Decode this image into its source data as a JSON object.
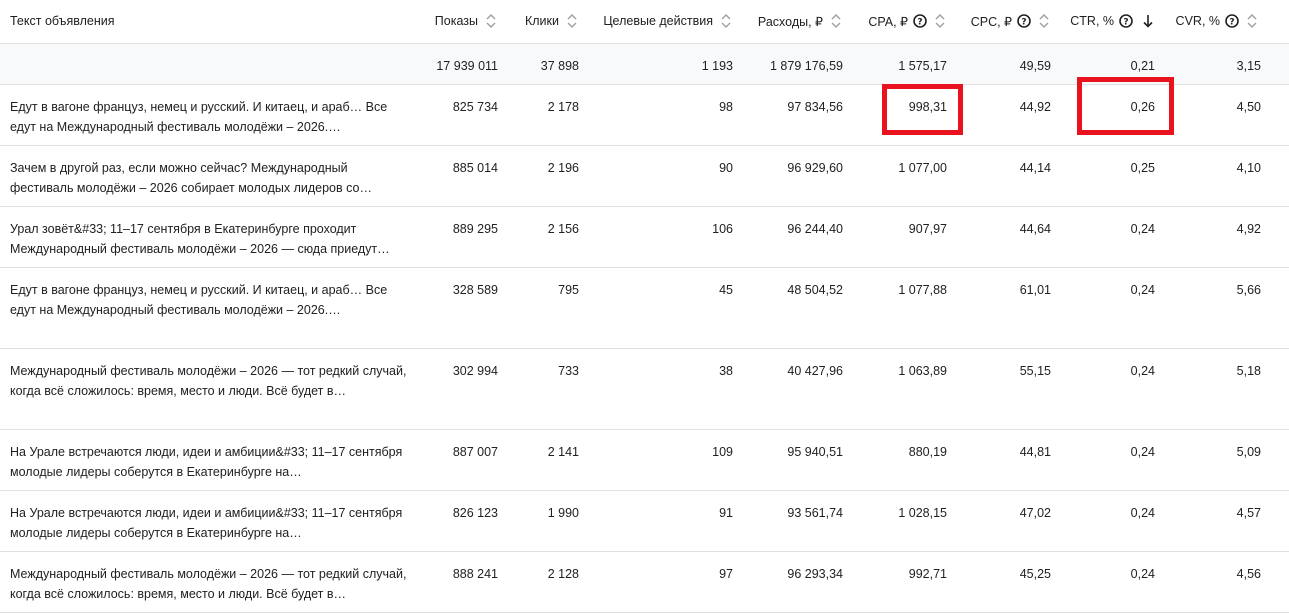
{
  "header": {
    "text": "Текст объявления",
    "impressions": "Показы",
    "clicks": "Клики",
    "conversions": "Целевые действия",
    "spend": "Расходы, ₽",
    "cpa": "CPA, ₽",
    "cpc": "CPC, ₽",
    "ctr": "CTR, %",
    "cvr": "CVR, %"
  },
  "totals": {
    "impressions": "17 939 011",
    "clicks": "37 898",
    "conversions": "1 193",
    "spend": "1 879 176,59",
    "cpa": "1 575,17",
    "cpc": "49,59",
    "ctr": "0,21",
    "cvr": "3,15"
  },
  "rows": [
    {
      "text": "Едут в вагоне француз, немец и русский. И китаец, и араб… Все едут на Международный фестиваль молодёжи – 2026.…",
      "impressions": "825 734",
      "clicks": "2 178",
      "conversions": "98",
      "spend": "97 834,56",
      "cpa": "998,31",
      "cpc": "44,92",
      "ctr": "0,26",
      "cvr": "4,50"
    },
    {
      "text": "Зачем в другой раз, если можно сейчас? Международный фестиваль молодёжи – 2026 собирает молодых лидеров со…",
      "impressions": "885 014",
      "clicks": "2 196",
      "conversions": "90",
      "spend": "96 929,60",
      "cpa": "1 077,00",
      "cpc": "44,14",
      "ctr": "0,25",
      "cvr": "4,10"
    },
    {
      "text": "Урал зовёт&#33; 11–17 сентября в Екатеринбурге проходит Международный фестиваль молодёжи – 2026 — сюда приедут…",
      "impressions": "889 295",
      "clicks": "2 156",
      "conversions": "106",
      "spend": "96 244,40",
      "cpa": "907,97",
      "cpc": "44,64",
      "ctr": "0,24",
      "cvr": "4,92"
    },
    {
      "text": "Едут в вагоне француз, немец и русский. И китаец, и араб… Все едут на Международный фестиваль молодёжи – 2026.…",
      "impressions": "328 589",
      "clicks": "795",
      "conversions": "45",
      "spend": "48 504,52",
      "cpa": "1 077,88",
      "cpc": "61,01",
      "ctr": "0,24",
      "cvr": "5,66"
    },
    {
      "text": "Международный фестиваль молодёжи – 2026 — тот редкий случай, когда всё сложилось: время, место и люди. Всё будет в…",
      "impressions": "302 994",
      "clicks": "733",
      "conversions": "38",
      "spend": "40 427,96",
      "cpa": "1 063,89",
      "cpc": "55,15",
      "ctr": "0,24",
      "cvr": "5,18"
    },
    {
      "text": "На Урале встречаются люди, идеи и амбиции&#33; 11–17 сентября молодые лидеры соберутся в Екатеринбурге на…",
      "impressions": "887 007",
      "clicks": "2 141",
      "conversions": "109",
      "spend": "95 940,51",
      "cpa": "880,19",
      "cpc": "44,81",
      "ctr": "0,24",
      "cvr": "5,09"
    },
    {
      "text": "На Урале встречаются люди, идеи и амбиции&#33; 11–17 сентября молодые лидеры соберутся в Екатеринбурге на…",
      "impressions": "826 123",
      "clicks": "1 990",
      "conversions": "91",
      "spend": "93 561,74",
      "cpa": "1 028,15",
      "cpc": "47,02",
      "ctr": "0,24",
      "cvr": "4,57"
    },
    {
      "text": "Международный фестиваль молодёжи – 2026 — тот редкий случай, когда всё сложилось: время, место и люди. Всё будет в…",
      "impressions": "888 241",
      "clicks": "2 128",
      "conversions": "97",
      "spend": "96 293,34",
      "cpa": "992,71",
      "cpc": "45,25",
      "ctr": "0,24",
      "cvr": "4,56"
    }
  ],
  "colors": {
    "highlight": "#e8131e",
    "border": "#e0e0e0",
    "total_bg": "#f8f9fa"
  }
}
